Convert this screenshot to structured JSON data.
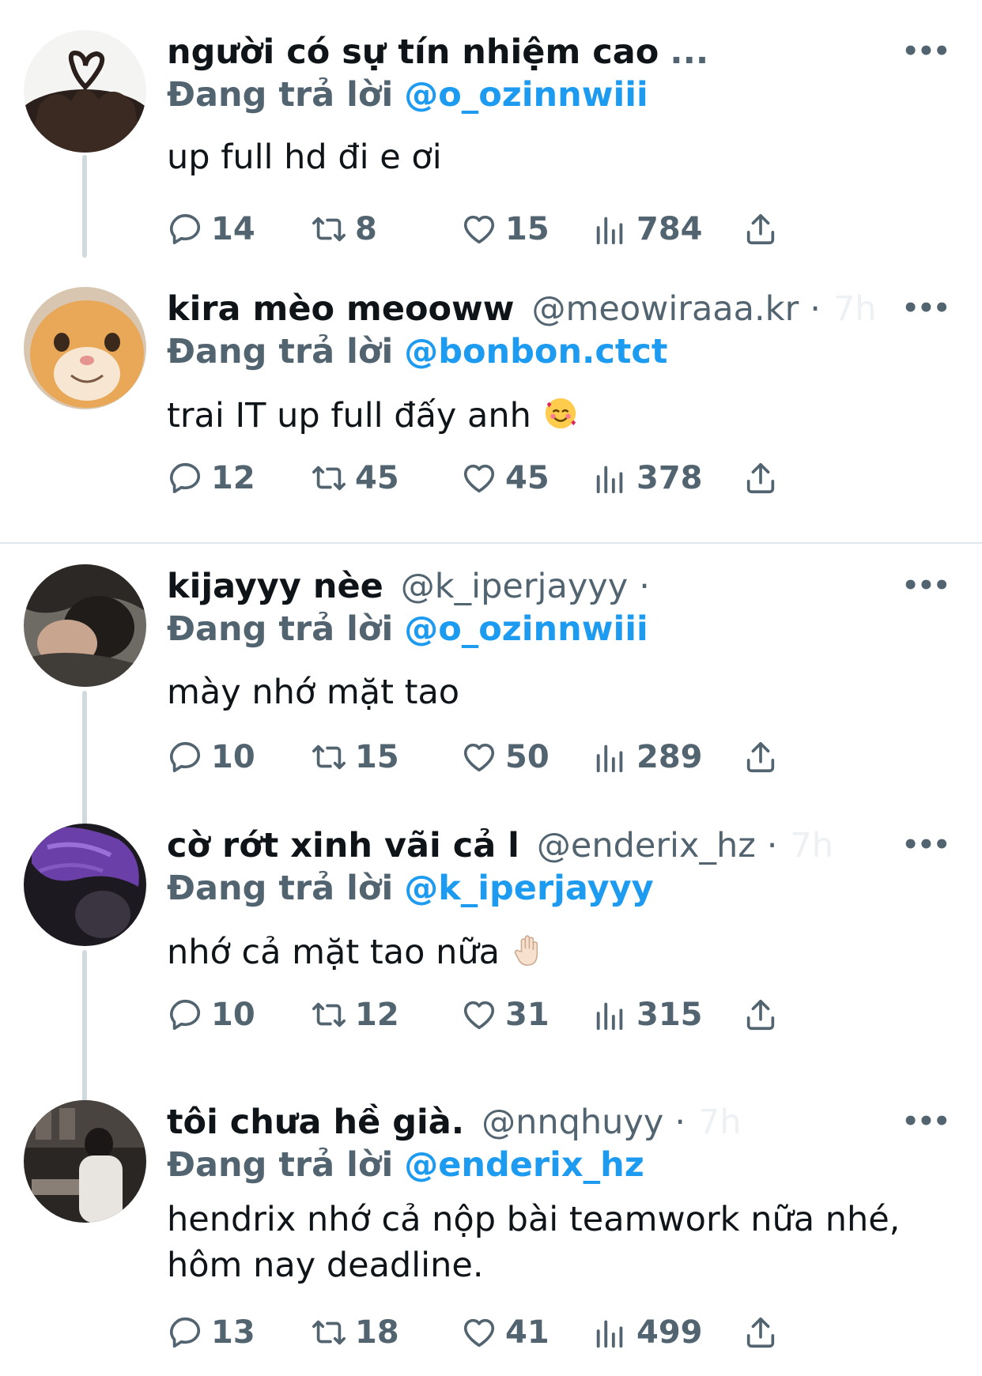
{
  "reply_prefix": "Đang trả lời",
  "more_glyph": "•••",
  "tweets": [
    {
      "name": "người có sự tín nhiệm cao",
      "name_trunc": "...",
      "handle": "",
      "dot": "",
      "time": "",
      "reply_to": "@o_ozinnwiii",
      "text": "up full hd đi e ơi",
      "replies": "14",
      "retweets": "8",
      "likes": "15",
      "views": "784"
    },
    {
      "name": "kira mèo meooww",
      "handle": "@meowiraaa.kr",
      "dot": "·",
      "time": "7h",
      "reply_to": "@bonbon.ctct",
      "text": "trai IT up full đấy anh",
      "replies": "12",
      "retweets": "45",
      "likes": "45",
      "views": "378"
    },
    {
      "name": "kijayyy nèe",
      "handle": "@k_iperjayyy",
      "dot": "·",
      "time": "",
      "reply_to": "@o_ozinnwiii",
      "text": "mày nhớ mặt tao",
      "replies": "10",
      "retweets": "15",
      "likes": "50",
      "views": "289"
    },
    {
      "name": "cờ rớt xinh vãi cả l",
      "handle": "@enderix_hz",
      "dot": "·",
      "time": "7h",
      "reply_to": "@k_iperjayyy",
      "text": "nhớ cả mặt tao nữa",
      "replies": "10",
      "retweets": "12",
      "likes": "31",
      "views": "315"
    },
    {
      "name": "tôi chưa hề già.",
      "handle": "@nnqhuyy",
      "dot": "·",
      "time": "7h",
      "reply_to": "@enderix_hz",
      "text_line1": "hendrix nhớ cả nộp bài teamwork nữa nhé,",
      "text_line2": "hôm nay deadline.",
      "replies": "13",
      "retweets": "18",
      "likes": "41",
      "views": "499"
    }
  ]
}
